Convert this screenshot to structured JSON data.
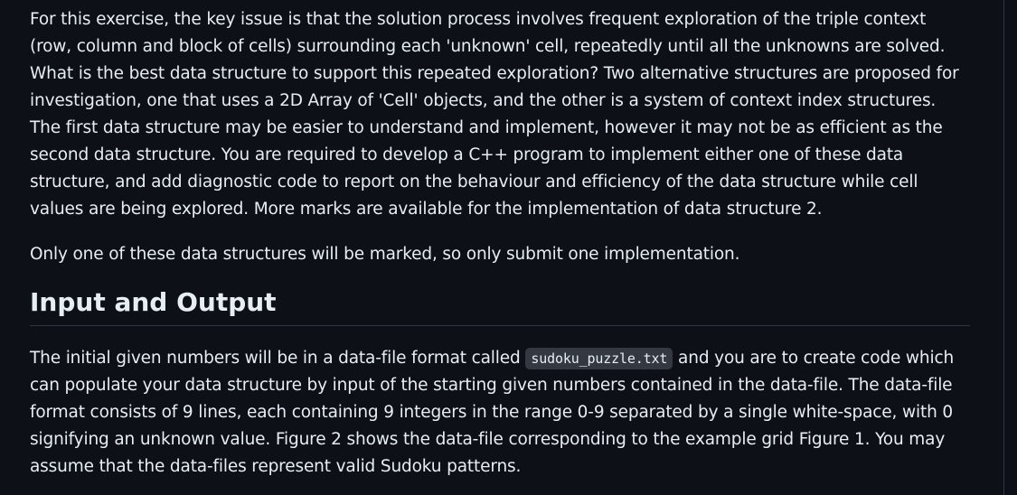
{
  "article": {
    "para1": "For this exercise, the key issue is that the solution process involves frequent exploration of the triple context (row, column and block of cells) surrounding each 'unknown' cell, repeatedly until all the unknowns are solved. What is the best data structure to support this repeated exploration? Two alternative structures are proposed for investigation, one that uses a 2D Array of 'Cell' objects, and the other is a system of context index structures. The first data structure may be easier to understand and implement, however it may not be as efficient as the second data structure. You are required to develop a C++ program to implement either one of these data structure, and add diagnostic code to report on the behaviour and efficiency of the data structure while cell values are being explored. More marks are available for the implementation of data structure 2.",
    "para2": "Only one of these data structures will be marked, so only submit one implementation.",
    "heading": "Input and Output",
    "para3_before": "The initial given numbers will be in a data-file format called ",
    "para3_code": "sudoku_puzzle.txt",
    "para3_after": " and you are to create code which can populate your data structure by input of the starting given numbers contained in the data-file. The data-file format consists of 9 lines, each containing 9 integers in the range 0-9 separated by a single white-space, with 0 signifying an unknown value. Figure 2 shows the data-file corresponding to the example grid Figure 1. You may assume that the data-files represent valid Sudoku patterns."
  }
}
